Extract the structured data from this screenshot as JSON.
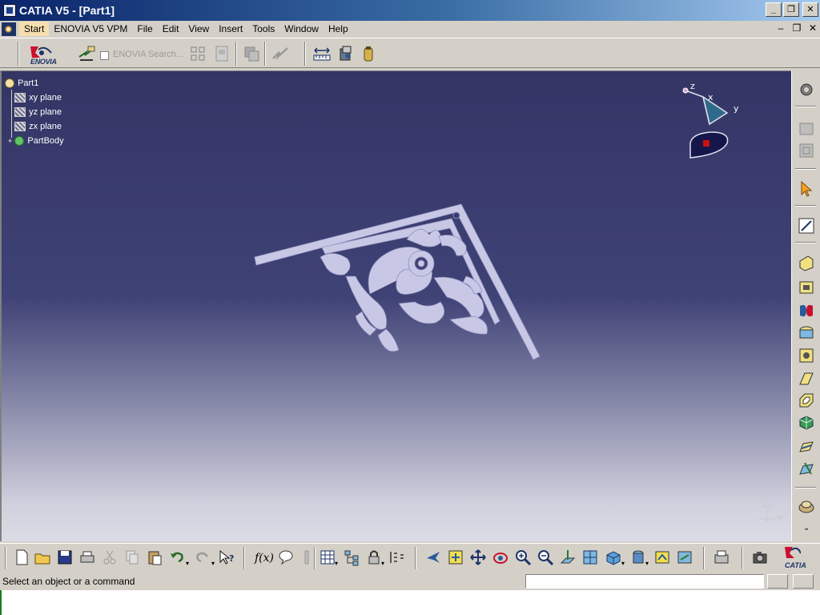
{
  "window": {
    "title": "CATIA V5 - [Part1]",
    "minimize_icon": "minimize-icon",
    "restore_icon": "restore-icon",
    "close_icon": "close-icon"
  },
  "menubar": {
    "items": [
      {
        "label": "Start",
        "active": true
      },
      {
        "label": "ENOVIA V5 VPM"
      },
      {
        "label": "File"
      },
      {
        "label": "Edit"
      },
      {
        "label": "View"
      },
      {
        "label": "Insert"
      },
      {
        "label": "Tools"
      },
      {
        "label": "Window"
      },
      {
        "label": "Help"
      }
    ]
  },
  "toptoolbar": {
    "logo_text": "ENOVIA",
    "search_label": "ENOVIA Search..."
  },
  "tree": {
    "root": "Part1",
    "items": [
      "xy plane",
      "yz plane",
      "zx plane",
      "PartBody"
    ]
  },
  "compass": {
    "x_label": "x",
    "y_label": "y",
    "z_label": "z"
  },
  "mini_axis": {
    "z_label": "Z",
    "x_label": "X",
    "y_label": "Y"
  },
  "bottomtoolbar": {
    "formula_label": "f(x)",
    "logo_text": "CATIA"
  },
  "statusbar": {
    "message": "Select an object or a command",
    "command_value": ""
  },
  "colors": {
    "viewport_top": "#333565",
    "viewport_bottom": "#dcdce6",
    "part_color": "#c8c8e6",
    "title_bar": "#0a246a"
  }
}
